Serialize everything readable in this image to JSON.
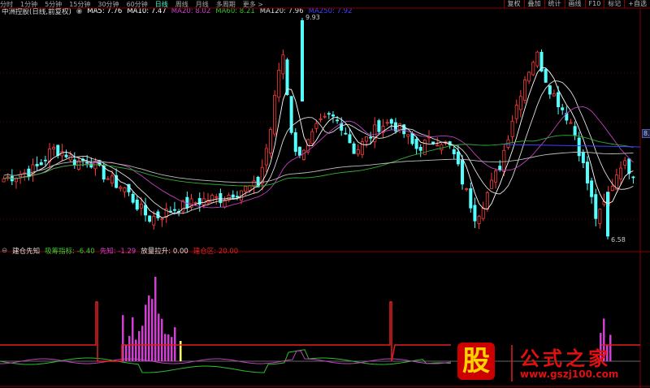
{
  "periods": [
    "分时",
    "1分钟",
    "5分钟",
    "15分钟",
    "30分钟",
    "60分钟",
    "日线",
    "周线",
    "月线",
    "多周期",
    "更多 >"
  ],
  "active_period": "日线",
  "right_buttons": [
    "复权",
    "叠加",
    "统计",
    "画线",
    "F10",
    "标记",
    "+自选"
  ],
  "stock_title": "中洲控股(日线,前复权)",
  "ma_legend": [
    {
      "label": "MA5: 7.76",
      "color": "#ffffff"
    },
    {
      "label": "MA10: 7.47",
      "color": "#ffffff"
    },
    {
      "label": "MA20: 8.02",
      "color": "#d040d0"
    },
    {
      "label": "MA60: 8.21",
      "color": "#30c030"
    },
    {
      "label": "MA120: 7.96",
      "color": "#dddddd"
    },
    {
      "label": "MA250: 7.92",
      "color": "#4040ff"
    }
  ],
  "high_label": "9.93",
  "low_label": "6.58",
  "right_price_label": "8.",
  "indicator": {
    "name": "建仓先知",
    "items": [
      {
        "label": "吸筹指标: -6.40",
        "color": "#30d030"
      },
      {
        "label": "先知: -1.29",
        "color": "#d040d0"
      },
      {
        "label": "放量拉升: 0.00",
        "color": "#dddddd"
      },
      {
        "label": "建仓区: 20.00",
        "color": "#e02020"
      }
    ]
  },
  "watermark": {
    "logo": "股",
    "title": "公式之家",
    "url": "www.gszj100.com"
  },
  "chart_data": {
    "type": "candlestick",
    "price_range": [
      6.58,
      9.93
    ],
    "key_closes": [
      7.5,
      7.55,
      7.6,
      7.7,
      7.95,
      7.9,
      7.75,
      7.8,
      7.6,
      7.45,
      7.35,
      7.1,
      6.9,
      6.95,
      7.05,
      7.1,
      7.15,
      7.2,
      7.2,
      7.3,
      7.35,
      7.4,
      8.2,
      9.5,
      7.85,
      8.0,
      8.3,
      8.45,
      8.3,
      7.9,
      8.1,
      8.3,
      8.35,
      8.2,
      7.95,
      8.05,
      8.1,
      7.95,
      7.4,
      6.9,
      7.3,
      7.7,
      8.4,
      9.0,
      9.4,
      8.9,
      8.6,
      8.3,
      7.6,
      6.85,
      7.3,
      7.75,
      7.6
    ],
    "indicator_bars": {
      "purple_ranges": [
        [
          150,
          215
        ],
        [
          738,
          753
        ]
      ]
    }
  }
}
